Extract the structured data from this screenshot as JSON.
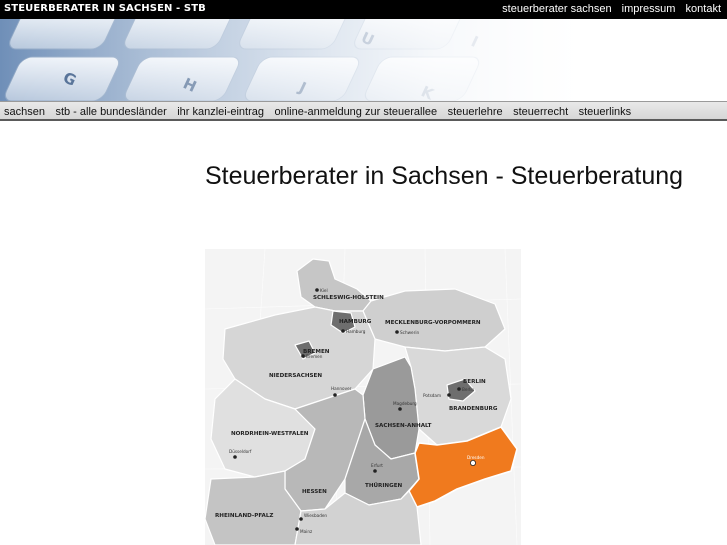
{
  "header": {
    "site_title": "STEUERBERATER IN SACHSEN - STB",
    "links": [
      "steuerberater sachsen",
      "impressum",
      "kontakt"
    ]
  },
  "banner": {
    "keys": [
      "G",
      "H",
      "J",
      "U",
      "K",
      "I"
    ]
  },
  "nav": {
    "items": [
      "sachsen",
      "stb - alle bundesländer",
      "ihr kanzlei-eintrag",
      "online-anmeldung zur steuerallee",
      "steuerlehre",
      "steuerrecht",
      "steuerlinks"
    ]
  },
  "main": {
    "title": "Steuerberater in Sachsen - Steuerberatung"
  },
  "map": {
    "highlight_color": "#f07a1e",
    "states": {
      "sh": "SCHLESWIG-HOLSTEIN",
      "hh": "HAMBURG",
      "mv": "MECKLENBURG-VORPOMMERN",
      "hb": "BREMEN",
      "ni": "NIEDERSACHSEN",
      "be": "BERLIN",
      "bb": "BRANDENBURG",
      "st": "SACHSEN-ANHALT",
      "nw": "NORDRHEIN-WESTFALEN",
      "sn": "SACHSEN",
      "th": "THÜRINGEN",
      "he": "HESSEN",
      "rp": "RHEINLAND-PFALZ"
    },
    "cities": {
      "kiel": "Kiel",
      "hamburg": "Hamburg",
      "schwerin": "Schwerin",
      "bremen": "Bremen",
      "hannover": "Hannover",
      "potsdam": "Potsdam",
      "berlin": "Berlin",
      "magdeburg": "Magdeburg",
      "duesseldorf": "Düsseldorf",
      "erfurt": "Erfurt",
      "dresden": "Dresden",
      "wiesbaden": "Wiesbaden",
      "mainz": "Mainz"
    }
  }
}
